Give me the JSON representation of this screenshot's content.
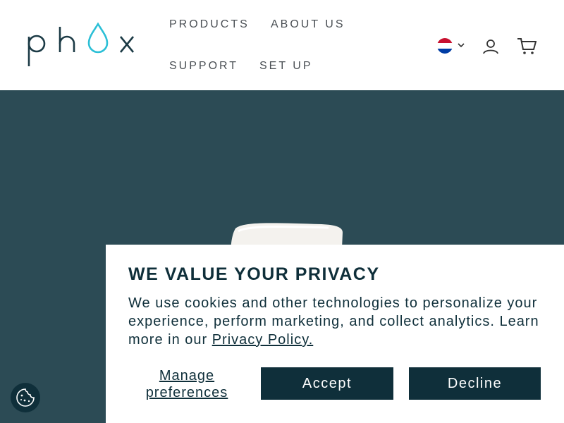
{
  "header": {
    "logo_alt": "phox",
    "nav": {
      "products": "PRODUCTS",
      "about": "ABOUT US",
      "support": "SUPPORT",
      "setup": "SET UP"
    },
    "language": {
      "flag": "netherlands-flag",
      "icon": "chevron-down-icon"
    },
    "icons": {
      "account": "user-icon",
      "cart": "cart-icon"
    }
  },
  "cookie_banner": {
    "title": "WE VALUE YOUR PRIVACY",
    "text": "We use cookies and other technologies to personalize your experience, perform marketing, and collect analytics. Learn more in our ",
    "link_text": "Privacy Policy.",
    "manage_label": "Manage preferences",
    "accept_label": "Accept",
    "decline_label": "Decline"
  },
  "colors": {
    "hero_bg": "#2c4b55",
    "button_bg": "#0f2f3a",
    "logo_drop": "#2bbfd6"
  }
}
